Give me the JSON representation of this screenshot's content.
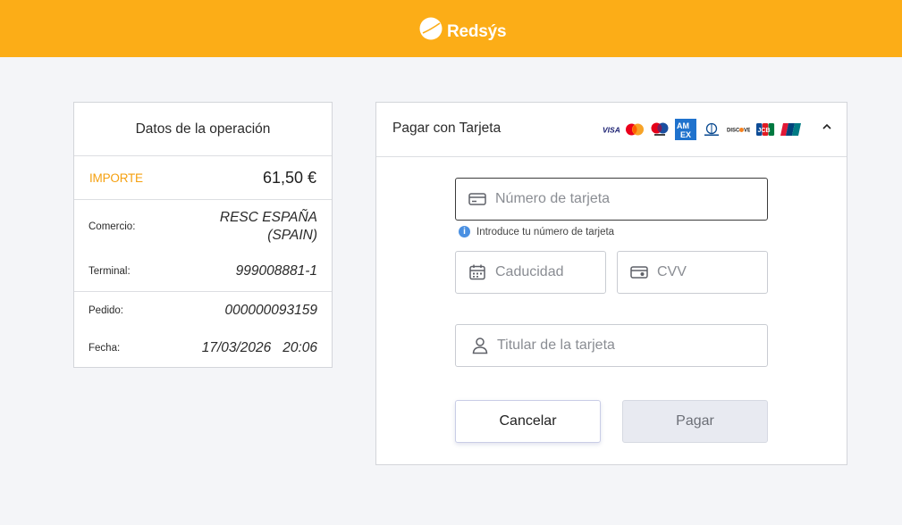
{
  "header": {
    "brand_name": "Redsýs",
    "background_color": "#fcad17"
  },
  "operation": {
    "title": "Datos de la operación",
    "amount_label": "IMPORTE",
    "amount_value": "61,50 €",
    "merchant_label": "Comercio:",
    "merchant_value_line1": "RESC ESPAÑA",
    "merchant_value_line2": "(SPAIN)",
    "terminal_label": "Terminal:",
    "terminal_value": "999008881-1",
    "order_label": "Pedido:",
    "order_value": "000000093159",
    "date_label": "Fecha:",
    "date_value": "17/03/2026",
    "time_value": "20:06",
    "accent_color": "#f5a00f"
  },
  "payment": {
    "title": "Pagar con Tarjeta",
    "brands": [
      "VISA",
      "Mastercard",
      "Maestro",
      "AMEX",
      "Diners Club",
      "DISCOVER",
      "JCB",
      "UnionPay"
    ],
    "card_number_placeholder": "Número de tarjeta",
    "card_number_hint": "Introduce tu número de tarjeta",
    "expiry_placeholder": "Caducidad",
    "cvv_placeholder": "CVV",
    "holder_placeholder": "Titular de la tarjeta",
    "cancel_label": "Cancelar",
    "pay_label": "Pagar",
    "icons": {
      "card": "credit-card-icon",
      "expiry": "calendar-icon",
      "cvv": "card-cvv-icon",
      "holder": "user-icon",
      "hint": "info-icon",
      "collapse": "chevron-up-icon"
    }
  }
}
